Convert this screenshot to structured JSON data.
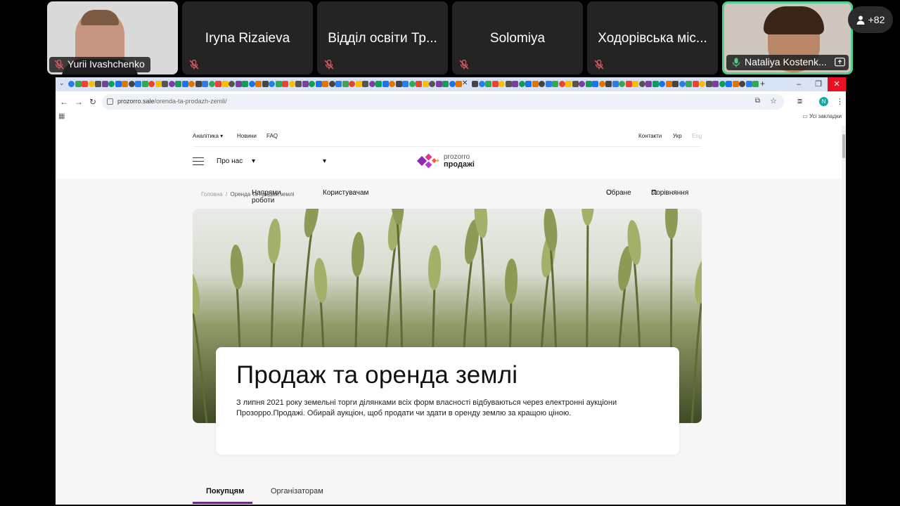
{
  "meeting": {
    "participants": [
      {
        "name": "Yurii Ivashchenko",
        "video": true
      },
      {
        "name": "Iryna Rizaieva",
        "video": false
      },
      {
        "name": "Відділ освіти Тр...",
        "video": false
      },
      {
        "name": "Solomiya",
        "video": false
      },
      {
        "name": "Ходорівська міс...",
        "video": false
      },
      {
        "name": "Nataliya Kostenk...",
        "video": true
      }
    ],
    "more_count": "+82"
  },
  "browser": {
    "url_host": "prozorro.sale",
    "url_path": "/orenda-ta-prodazh-zemli/",
    "profile_initial": "N",
    "all_bookmarks": "Усі закладки"
  },
  "site": {
    "topnav": {
      "analytics": "Аналітика",
      "news": "Новини",
      "faq": "FAQ",
      "contacts": "Контакти",
      "lang_ukr": "Укр",
      "lang_eng": "Eng"
    },
    "mainnav": {
      "about": "Про нас",
      "directions": "Напрями роботи",
      "users": "Користувачам",
      "favorites": "Обране",
      "compare": "Порівняння"
    },
    "logo": {
      "line1": "prozorro",
      "line2": "продажі"
    },
    "breadcrumb": {
      "home": "Головна",
      "sep": "/",
      "current": "Оренда та продаж землі"
    },
    "hero": {
      "title": "Продаж та оренда землі",
      "description": "З липня 2021 року земельні торги ділянками всіх форм власності відбуваються через електронні аукціони Прозорро.Продажі. Обирай аукціон, щоб продати чи здати в оренду землю за кращою ціною."
    },
    "tabs": [
      {
        "label": "Покупцям",
        "active": true
      },
      {
        "label": "Організаторам",
        "active": false
      }
    ]
  },
  "colors": {
    "accent": "#6b2a8a",
    "active_speaker": "#4fd08c",
    "close": "#e81123"
  }
}
